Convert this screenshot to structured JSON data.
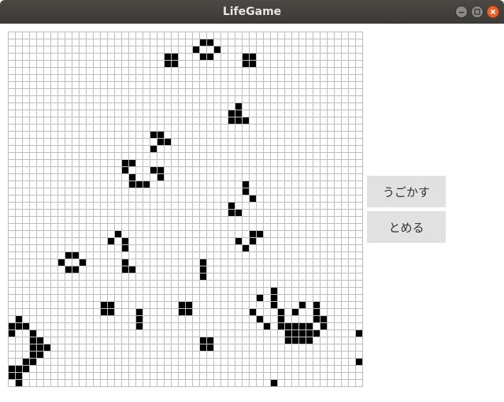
{
  "window": {
    "title": "LifeGame",
    "controls": [
      {
        "name": "minimize",
        "icon": "minimize-icon"
      },
      {
        "name": "maximize",
        "icon": "maximize-icon"
      },
      {
        "name": "close",
        "icon": "close-icon"
      }
    ]
  },
  "controls": {
    "start_label": "うごかす",
    "stop_label": "とめる"
  },
  "board": {
    "columns": 50,
    "rows": 50,
    "colors": {
      "grid": "#bdbdbd",
      "live": "#000000",
      "dead": "#ffffff"
    },
    "live_cells": [
      [
        27,
        1
      ],
      [
        28,
        1
      ],
      [
        26,
        2
      ],
      [
        29,
        2
      ],
      [
        22,
        3
      ],
      [
        23,
        3
      ],
      [
        27,
        3
      ],
      [
        28,
        3
      ],
      [
        33,
        3
      ],
      [
        34,
        3
      ],
      [
        22,
        4
      ],
      [
        23,
        4
      ],
      [
        33,
        4
      ],
      [
        34,
        4
      ],
      [
        32,
        10
      ],
      [
        31,
        11
      ],
      [
        32,
        11
      ],
      [
        31,
        12
      ],
      [
        32,
        12
      ],
      [
        33,
        12
      ],
      [
        20,
        14
      ],
      [
        21,
        14
      ],
      [
        21,
        15
      ],
      [
        22,
        15
      ],
      [
        20,
        16
      ],
      [
        16,
        18
      ],
      [
        17,
        18
      ],
      [
        16,
        19
      ],
      [
        20,
        19
      ],
      [
        21,
        19
      ],
      [
        17,
        20
      ],
      [
        21,
        20
      ],
      [
        17,
        21
      ],
      [
        18,
        21
      ],
      [
        19,
        21
      ],
      [
        33,
        21
      ],
      [
        33,
        22
      ],
      [
        34,
        23
      ],
      [
        31,
        24
      ],
      [
        31,
        25
      ],
      [
        32,
        25
      ],
      [
        15,
        28
      ],
      [
        34,
        28
      ],
      [
        35,
        28
      ],
      [
        14,
        29
      ],
      [
        16,
        29
      ],
      [
        32,
        29
      ],
      [
        34,
        29
      ],
      [
        16,
        30
      ],
      [
        33,
        30
      ],
      [
        8,
        31
      ],
      [
        9,
        31
      ],
      [
        7,
        32
      ],
      [
        10,
        32
      ],
      [
        27,
        32
      ],
      [
        8,
        33
      ],
      [
        9,
        33
      ],
      [
        27,
        33
      ],
      [
        16,
        32
      ],
      [
        16,
        33
      ],
      [
        17,
        33
      ],
      [
        27,
        34
      ],
      [
        37,
        36
      ],
      [
        35,
        37
      ],
      [
        37,
        37
      ],
      [
        13,
        38
      ],
      [
        14,
        38
      ],
      [
        24,
        38
      ],
      [
        25,
        38
      ],
      [
        37,
        38
      ],
      [
        41,
        38
      ],
      [
        43,
        38
      ],
      [
        13,
        39
      ],
      [
        14,
        39
      ],
      [
        18,
        39
      ],
      [
        24,
        39
      ],
      [
        25,
        39
      ],
      [
        34,
        39
      ],
      [
        38,
        39
      ],
      [
        40,
        39
      ],
      [
        43,
        39
      ],
      [
        1,
        40
      ],
      [
        18,
        40
      ],
      [
        35,
        40
      ],
      [
        38,
        40
      ],
      [
        43,
        40
      ],
      [
        44,
        40
      ],
      [
        0,
        41
      ],
      [
        1,
        41
      ],
      [
        2,
        41
      ],
      [
        18,
        41
      ],
      [
        36,
        41
      ],
      [
        38,
        41
      ],
      [
        39,
        41
      ],
      [
        40,
        41
      ],
      [
        41,
        41
      ],
      [
        42,
        41
      ],
      [
        44,
        41
      ],
      [
        0,
        42
      ],
      [
        3,
        42
      ],
      [
        39,
        42
      ],
      [
        40,
        42
      ],
      [
        41,
        42
      ],
      [
        42,
        42
      ],
      [
        43,
        42
      ],
      [
        49,
        42
      ],
      [
        3,
        43
      ],
      [
        4,
        43
      ],
      [
        27,
        43
      ],
      [
        28,
        43
      ],
      [
        39,
        43
      ],
      [
        40,
        43
      ],
      [
        41,
        43
      ],
      [
        42,
        43
      ],
      [
        3,
        44
      ],
      [
        4,
        44
      ],
      [
        5,
        44
      ],
      [
        27,
        44
      ],
      [
        28,
        44
      ],
      [
        3,
        45
      ],
      [
        4,
        45
      ],
      [
        2,
        46
      ],
      [
        3,
        46
      ],
      [
        49,
        46
      ],
      [
        0,
        47
      ],
      [
        1,
        47
      ],
      [
        2,
        47
      ],
      [
        0,
        48
      ],
      [
        1,
        48
      ],
      [
        1,
        49
      ],
      [
        37,
        49
      ]
    ]
  }
}
